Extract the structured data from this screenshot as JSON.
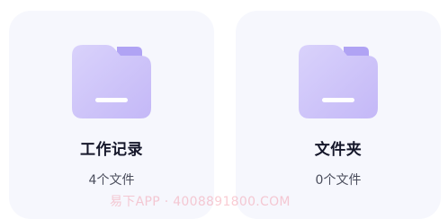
{
  "cards": [
    {
      "icon": "folder-icon",
      "title": "工作记录",
      "count": "4个文件"
    },
    {
      "icon": "folder-icon",
      "title": "文件夹",
      "count": "0个文件"
    }
  ],
  "watermark": "易下APP · 4008891800.COM",
  "colors": {
    "card_bg": "#f6f7fd",
    "folder_front": "#c9bff9",
    "folder_back": "#b0a3f4",
    "folder_bar": "#ffffff",
    "title": "#15172a",
    "count": "#4a4d5c"
  }
}
